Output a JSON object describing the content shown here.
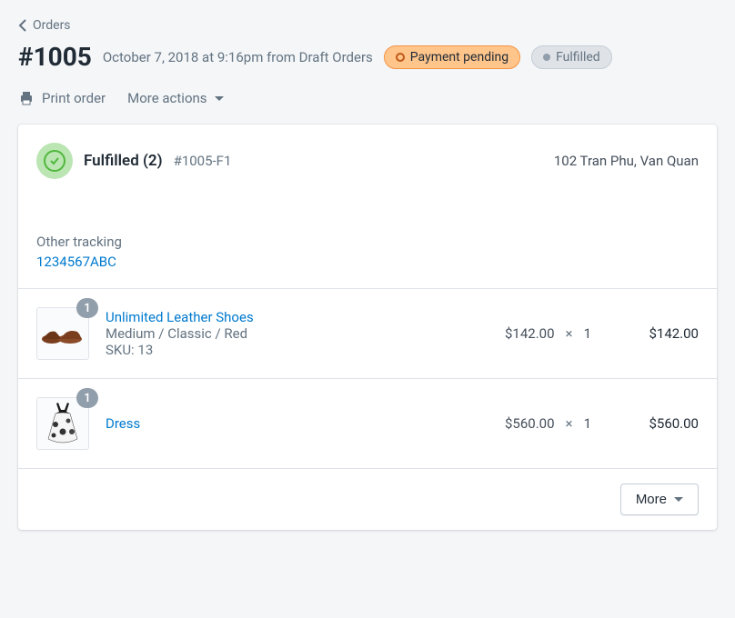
{
  "breadcrumb": {
    "label": "Orders"
  },
  "header": {
    "order_number": "#1005",
    "date_line": "October 7, 2018 at 9:16pm from Draft Orders",
    "payment_badge": "Payment pending",
    "fulfillment_badge": "Fulfilled"
  },
  "actions": {
    "print_label": "Print order",
    "more_label": "More actions"
  },
  "fulfillment": {
    "title": "Fulfilled (2)",
    "id": "#1005-F1",
    "address": "102 Tran Phu, Van Quan",
    "tracking_label": "Other tracking",
    "tracking_number": "1234567ABC"
  },
  "line_items": [
    {
      "qty_badge": "1",
      "name": "Unlimited Leather Shoes",
      "variant": "Medium / Classic / Red",
      "sku": "SKU: 13",
      "unit_price": "$142.00",
      "multiplier": "×",
      "quantity": "1",
      "total": "$142.00",
      "thumb_kind": "shoes"
    },
    {
      "qty_badge": "1",
      "name": "Dress",
      "variant": "",
      "sku": "",
      "unit_price": "$560.00",
      "multiplier": "×",
      "quantity": "1",
      "total": "$560.00",
      "thumb_kind": "dress"
    }
  ],
  "footer": {
    "more_button": "More"
  }
}
